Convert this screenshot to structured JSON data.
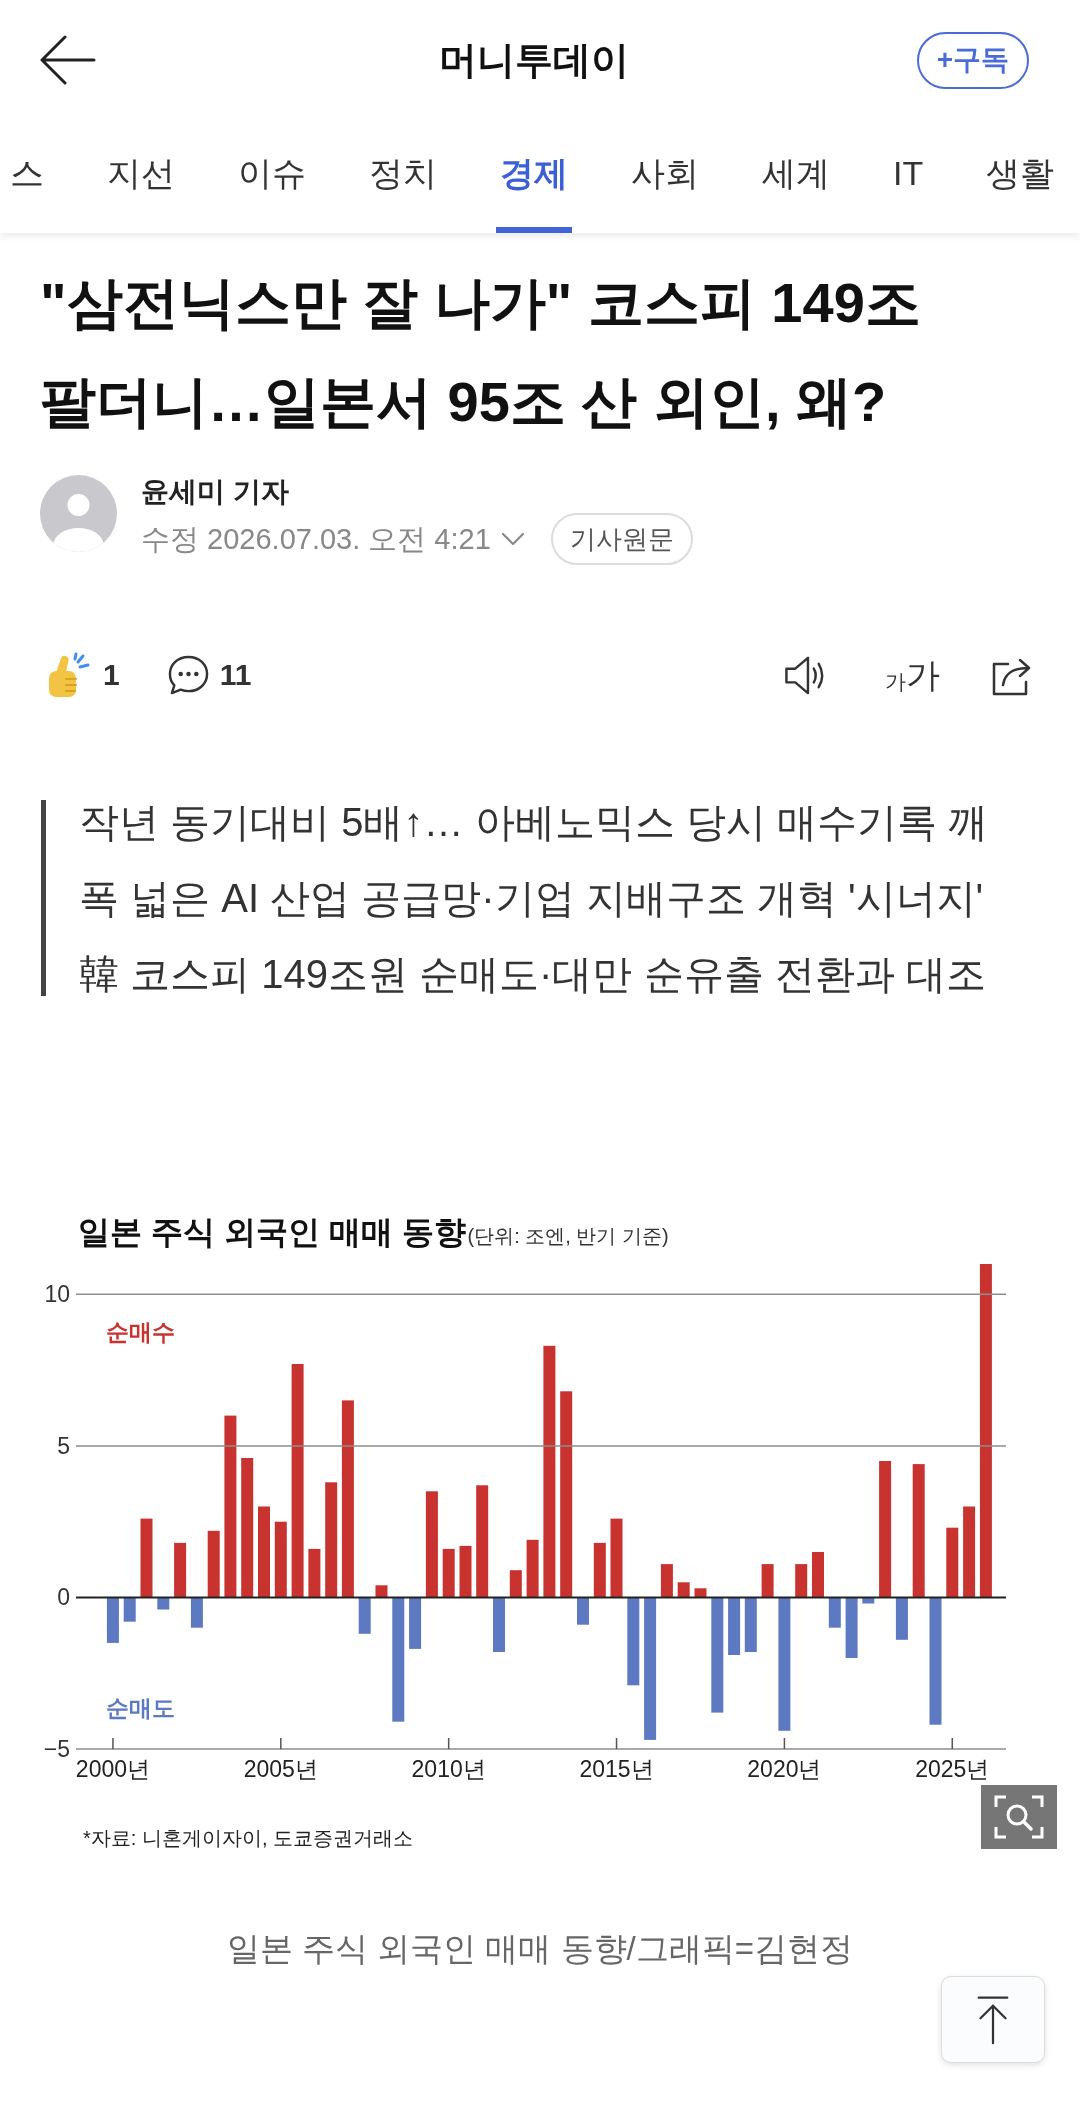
{
  "header": {
    "title": "머니투데이",
    "subscribe_button": "+구독"
  },
  "tabs": [
    {
      "label": "스",
      "selected": false
    },
    {
      "label": "지선",
      "selected": false
    },
    {
      "label": "이슈",
      "selected": false
    },
    {
      "label": "정치",
      "selected": false
    },
    {
      "label": "경제",
      "selected": true
    },
    {
      "label": "사회",
      "selected": false
    },
    {
      "label": "세계",
      "selected": false
    },
    {
      "label": "IT",
      "selected": false
    },
    {
      "label": "생활",
      "selected": false
    }
  ],
  "article": {
    "title": "\"삼전닉스만 잘 나가\" 코스피 149조 팔더니…일본서 95조 산 외인, 왜?",
    "author": {
      "name": "윤세미 기자",
      "updated": "수정 2026.07.03. 오전 4:21",
      "original_button": "기사원문"
    },
    "reactions": {
      "likes": "1",
      "comments": "11"
    },
    "text_size_button": {
      "small": "가",
      "large": "가"
    },
    "summary": [
      "작년 동기대비 5배↑… 아베노믹스 당시 매수기록 깨",
      "폭 넓은 AI 산업 공급망·기업 지배구조 개혁 '시너지'",
      "韓 코스피 149조원 순매도·대만 순유출 전환과 대조"
    ],
    "figure": {
      "chart_data": {
        "type": "bar",
        "title": "일본 주식 외국인 매매 동향",
        "x": [
          2000,
          2000.5,
          2001,
          2001.5,
          2002,
          2002.5,
          2003,
          2003.5,
          2004,
          2004.5,
          2005,
          2005.5,
          2006,
          2006.5,
          2007,
          2007.5,
          2008,
          2008.5,
          2009,
          2009.5,
          2010,
          2010.5,
          2011,
          2011.5,
          2012,
          2012.5,
          2013,
          2013.5,
          2014,
          2014.5,
          2015,
          2015.5,
          2016,
          2016.5,
          2017,
          2017.5,
          2018,
          2018.5,
          2019,
          2019.5,
          2020,
          2020.5,
          2021,
          2021.5,
          2022,
          2022.5,
          2023,
          2023.5,
          2024,
          2024.5,
          2025,
          2025.5,
          2026
        ],
        "series": [
          {
            "name": "순매수",
            "color": "#c8322f",
            "values": [
              null,
              null,
              2.6,
              null,
              1.8,
              null,
              2.2,
              6.0,
              4.6,
              3.0,
              2.5,
              7.7,
              1.6,
              3.8,
              6.5,
              null,
              0.4,
              null,
              null,
              3.5,
              1.6,
              1.7,
              3.7,
              null,
              0.9,
              1.9,
              8.3,
              6.8,
              null,
              1.8,
              2.6,
              null,
              null,
              1.1,
              0.5,
              0.3,
              null,
              null,
              null,
              1.1,
              null,
              1.1,
              1.5,
              null,
              null,
              null,
              4.5,
              null,
              4.4,
              null,
              2.3,
              3.0,
              11.0
            ]
          },
          {
            "name": "순매도",
            "color": "#5d79c1",
            "values": [
              -1.5,
              -0.8,
              null,
              -0.4,
              null,
              -1.0,
              null,
              null,
              null,
              null,
              null,
              null,
              null,
              null,
              null,
              -1.2,
              null,
              -4.1,
              -1.7,
              null,
              null,
              null,
              null,
              -1.8,
              null,
              null,
              null,
              null,
              -0.9,
              null,
              null,
              -2.9,
              -4.7,
              null,
              null,
              null,
              -3.8,
              -1.9,
              -1.8,
              null,
              -4.4,
              null,
              null,
              -1.0,
              -2.0,
              -0.2,
              null,
              -1.4,
              null,
              -4.2,
              null,
              null,
              null
            ]
          }
        ],
        "stacked": true,
        "xlim": [
          1998.9,
          2026.6
        ],
        "ylim": [
          -5,
          11
        ],
        "xticks": [
          {
            "value": 2000,
            "label": "2000년"
          },
          {
            "value": 2005,
            "label": "2005년"
          },
          {
            "value": 2010,
            "label": "2010년"
          },
          {
            "value": 2015,
            "label": "2015년"
          },
          {
            "value": 2020,
            "label": "2020년"
          },
          {
            "value": 2025,
            "label": "2025년"
          }
        ],
        "yticks": [
          {
            "value": -5,
            "label": "−5"
          },
          0,
          5,
          10
        ]
      },
      "unit_note": "(단위: 조엔, 반기 기준)",
      "source": "*자료: 니혼게이자이, 도쿄증권거래소",
      "caption": "일본 주식 외국인 매매 동향/그래픽=김현정"
    }
  }
}
